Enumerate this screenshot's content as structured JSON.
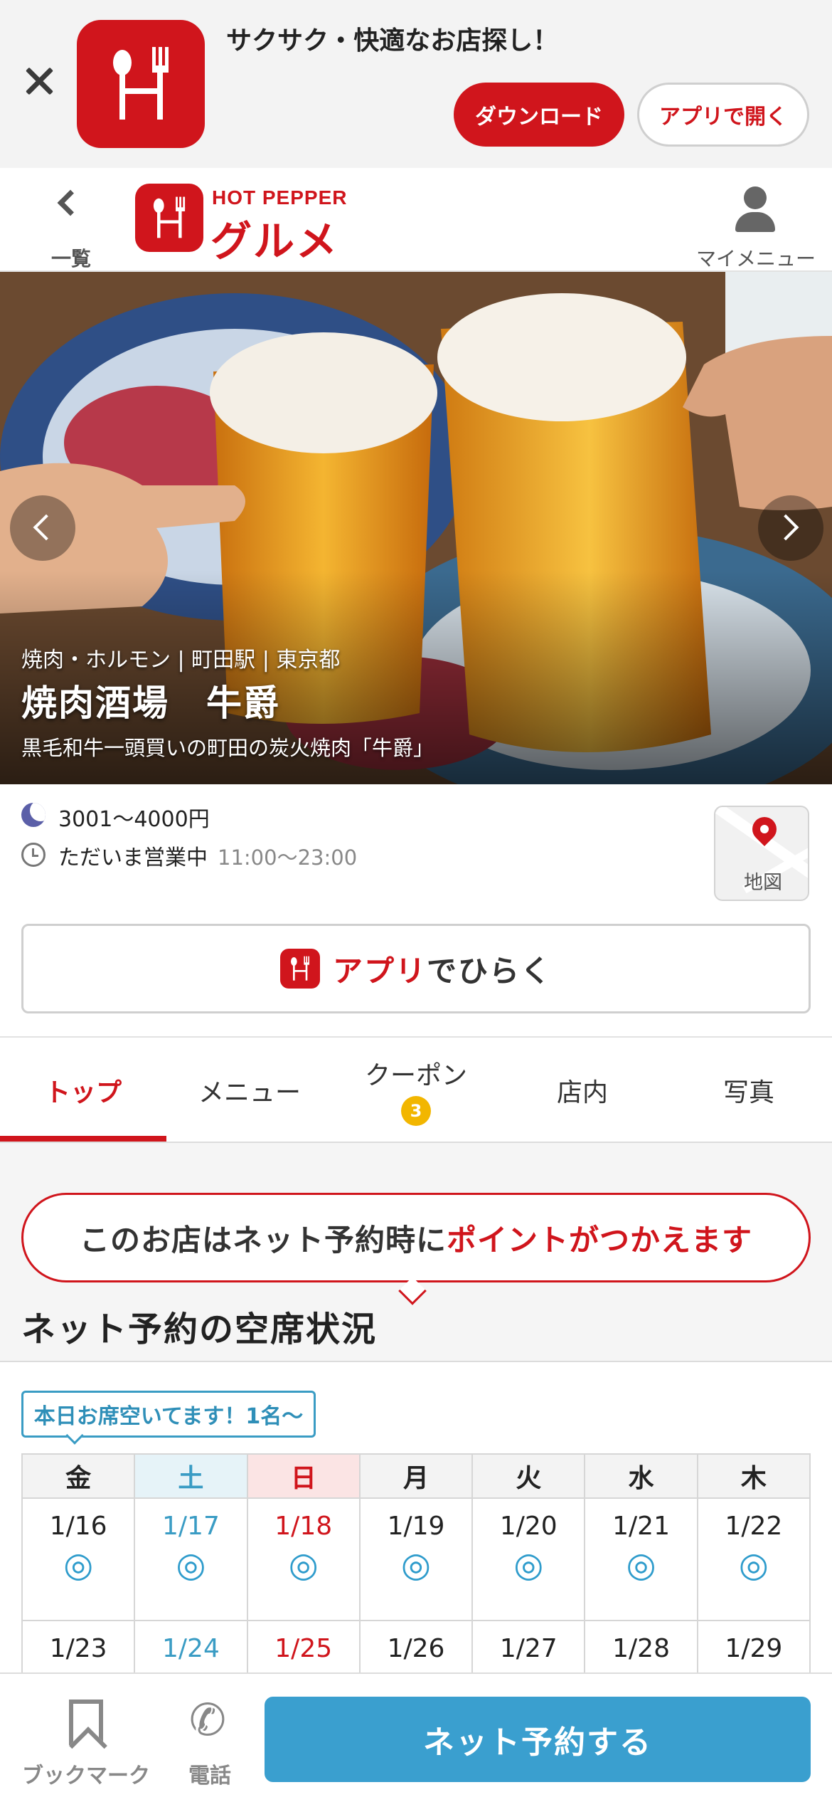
{
  "app_banner": {
    "tagline": "サクサク・快適なお店探し！",
    "download_label": "ダウンロード",
    "open_app_label": "アプリで開く"
  },
  "header": {
    "back_label": "一覧",
    "brand_top": "HOT PEPPER",
    "brand_main": "グルメ",
    "mymenu_label": "マイメニュー"
  },
  "hero": {
    "genre_area": "焼肉・ホルモン | 町田駅 | 東京都",
    "shop_name": "焼肉酒場　牛爵",
    "catch_copy": "黒毛和牛一頭買いの町田の炭火焼肉「牛爵」"
  },
  "info": {
    "budget": "3001〜4000円",
    "open_status": "ただいま営業中",
    "open_hours": "11:00〜23:00",
    "map_label": "地図"
  },
  "open_in_app": {
    "part_red": "アプリ",
    "part_dark": "でひらく"
  },
  "tabs": [
    {
      "label": "トップ"
    },
    {
      "label": "メニュー"
    },
    {
      "label": "クーポン",
      "badge": "3"
    },
    {
      "label": "店内"
    },
    {
      "label": "写真"
    }
  ],
  "reservation": {
    "points_dark": "このお店はネット予約時に",
    "points_red": "ポイントがつかえます",
    "heading": "ネット予約の空席状況",
    "availability_badge": "本日お席空いてます！1名〜",
    "weekdays": [
      "金",
      "土",
      "日",
      "月",
      "火",
      "水",
      "木"
    ],
    "weeks": [
      [
        "1/16",
        "1/17",
        "1/18",
        "1/19",
        "1/20",
        "1/21",
        "1/22"
      ],
      [
        "1/23",
        "1/24",
        "1/25",
        "1/26",
        "1/27",
        "1/28",
        "1/29"
      ]
    ],
    "mark": "◎"
  },
  "bottom_bar": {
    "bookmark_label": "ブックマーク",
    "phone_label": "電話",
    "reserve_label": "ネット予約する"
  },
  "colors": {
    "brand_red": "#d0151c",
    "reserve_blue": "#3a9fcf",
    "saturday_blue": "#3a9cc4"
  }
}
